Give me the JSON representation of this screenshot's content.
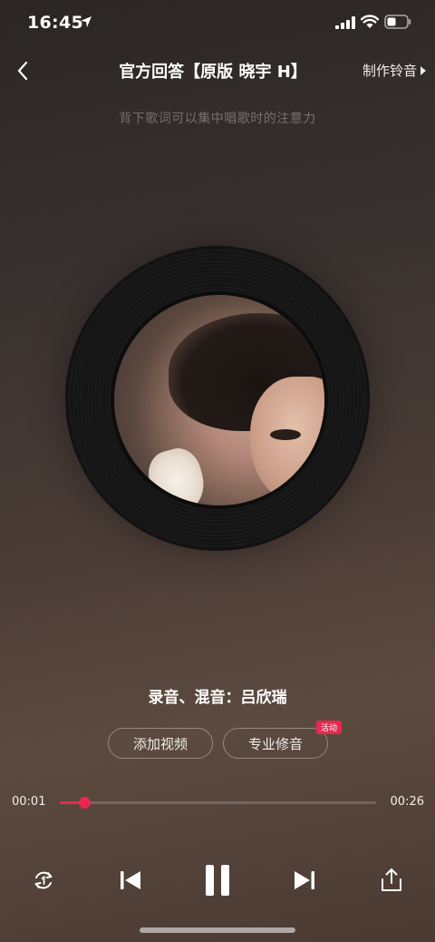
{
  "status_bar": {
    "time": "16:45"
  },
  "nav": {
    "title": "官方回答【原版 晓宇 H】",
    "ringtone_label": "制作铃音"
  },
  "hint": "背下歌词可以集中唱歌时的注意力",
  "credit": "录音、混音：吕欣瑞",
  "actions": {
    "add_video": "添加视频",
    "pro_edit": "专业修音",
    "badge": "活动"
  },
  "progress": {
    "current": "00:01",
    "total": "00:26",
    "fraction": 0.08
  },
  "controls": {
    "state": "playing"
  },
  "colors": {
    "accent": "#e7294f"
  }
}
